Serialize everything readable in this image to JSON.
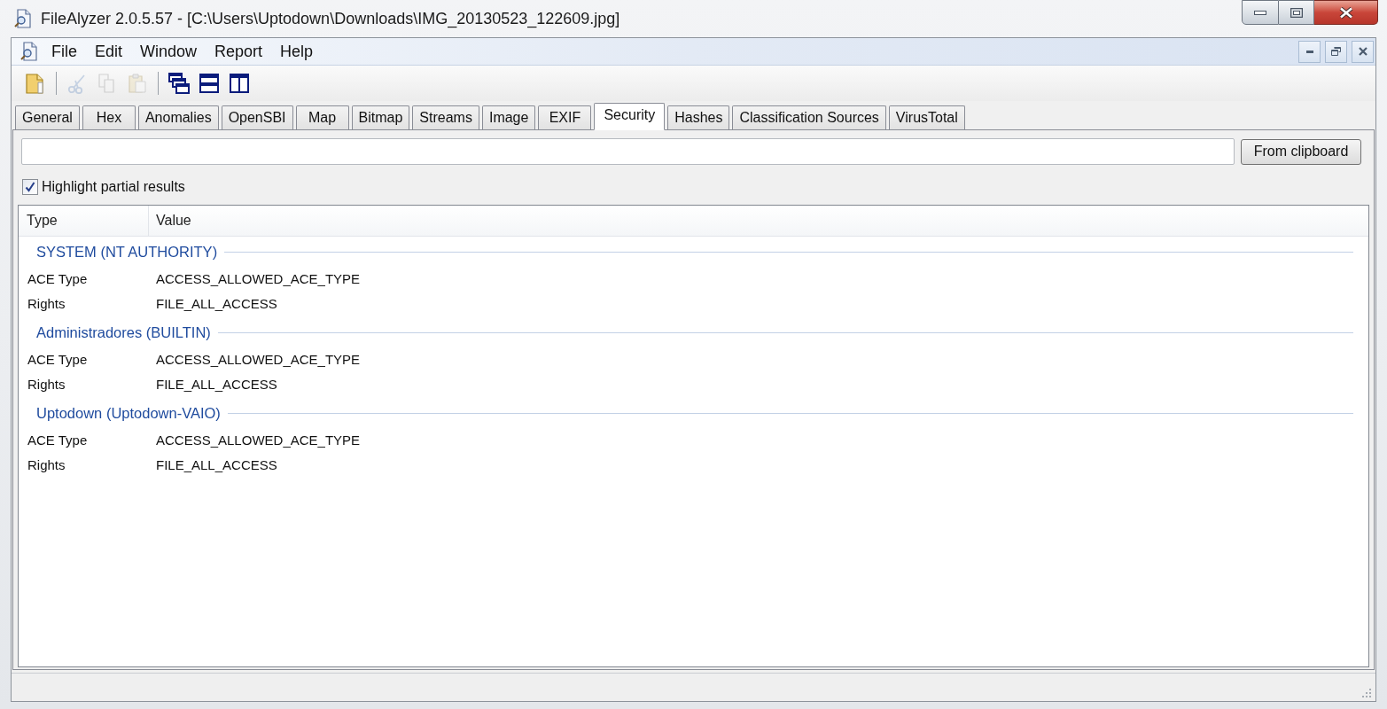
{
  "window": {
    "title": "FileAlyzer 2.0.5.57 - [C:\\Users\\Uptodown\\Downloads\\IMG_20130523_122609.jpg]"
  },
  "menu": [
    "File",
    "Edit",
    "Window",
    "Report",
    "Help"
  ],
  "toolbar": [
    {
      "buttons": [
        {
          "disabled": false
        }
      ]
    },
    {
      "buttons": [
        {
          "disabled": true
        },
        {
          "disabled": true
        },
        {
          "disabled": true
        }
      ]
    },
    {
      "buttons": [
        {
          "disabled": false
        },
        {
          "disabled": false
        },
        {
          "disabled": false
        }
      ]
    }
  ],
  "tabs": [
    {
      "label": "General",
      "selected": false
    },
    {
      "label": "Hex",
      "selected": false
    },
    {
      "label": "Anomalies",
      "selected": false
    },
    {
      "label": "OpenSBI",
      "selected": false
    },
    {
      "label": "Map",
      "selected": false
    },
    {
      "label": "Bitmap",
      "selected": false
    },
    {
      "label": "Streams",
      "selected": false
    },
    {
      "label": "Image",
      "selected": false
    },
    {
      "label": "EXIF",
      "selected": false
    },
    {
      "label": "Security",
      "selected": true
    },
    {
      "label": "Hashes",
      "selected": false
    },
    {
      "label": "Classification Sources",
      "selected": false
    },
    {
      "label": "VirusTotal",
      "selected": false
    }
  ],
  "clipboard_button": "From clipboard",
  "options": [
    {
      "label": "Highlight partial results",
      "checked": true
    }
  ],
  "table": {
    "columns": [
      "Type",
      "Value"
    ],
    "groups": [
      {
        "title": "SYSTEM (NT AUTHORITY)",
        "rows": [
          {
            "type": "ACE Type",
            "value": "ACCESS_ALLOWED_ACE_TYPE"
          },
          {
            "type": "Rights",
            "value": "FILE_ALL_ACCESS"
          }
        ]
      },
      {
        "title": "Administradores (BUILTIN)",
        "rows": [
          {
            "type": "ACE Type",
            "value": "ACCESS_ALLOWED_ACE_TYPE"
          },
          {
            "type": "Rights",
            "value": "FILE_ALL_ACCESS"
          }
        ]
      },
      {
        "title": "Uptodown (Uptodown-VAIO)",
        "rows": [
          {
            "type": "ACE Type",
            "value": "ACCESS_ALLOWED_ACE_TYPE"
          },
          {
            "type": "Rights",
            "value": "FILE_ALL_ACCESS"
          }
        ]
      }
    ]
  }
}
